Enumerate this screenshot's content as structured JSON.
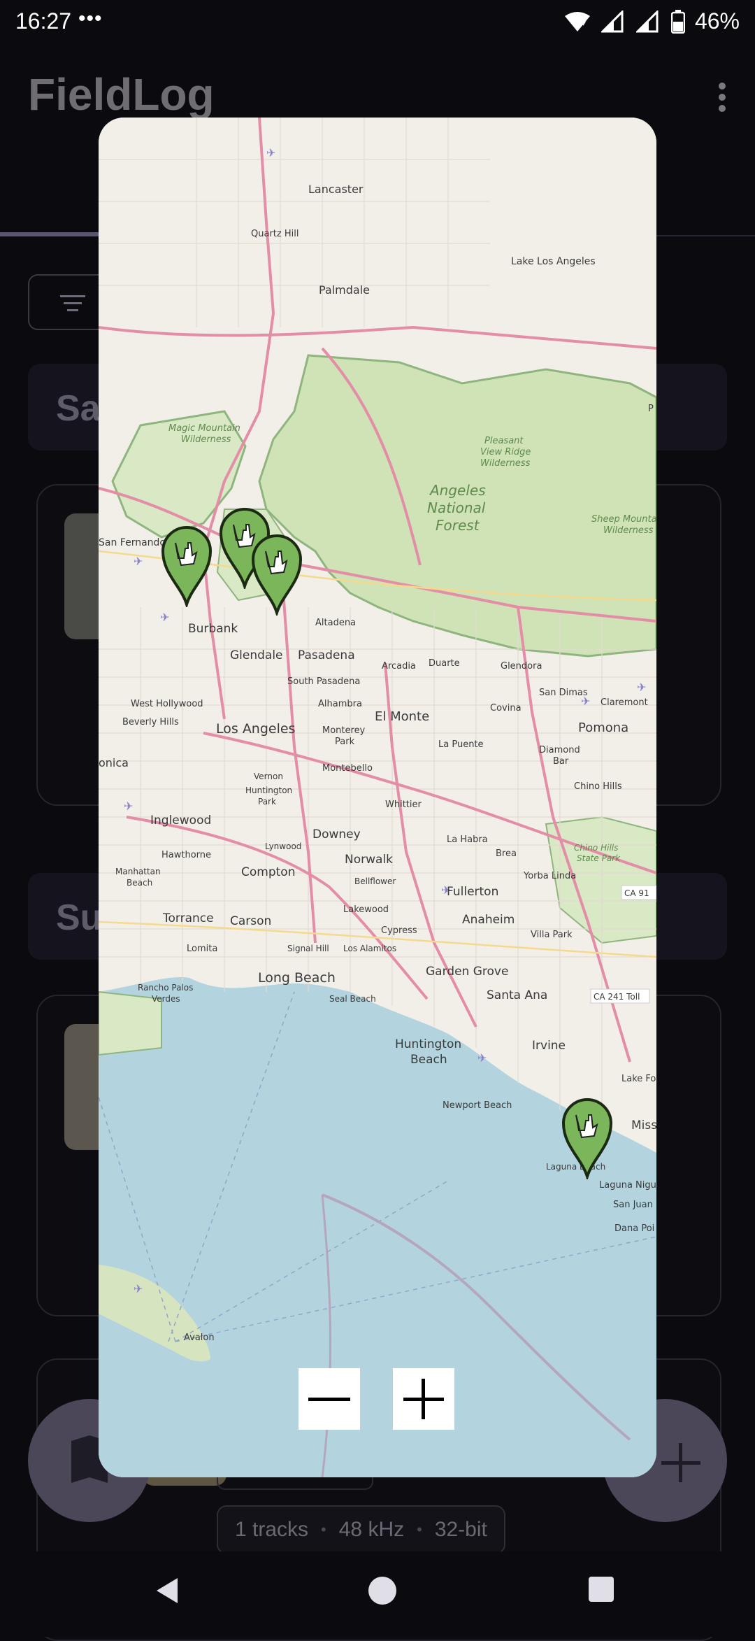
{
  "status_bar": {
    "time": "16:27",
    "overflow_dots": "•••",
    "battery": "46%"
  },
  "app_bar": {
    "title": "FieldLog"
  },
  "sections": [
    {
      "label": "Sa"
    },
    {
      "label": "Su"
    }
  ],
  "recording": {
    "tracks": "1 tracks",
    "sample_rate": "48 kHz",
    "bit_depth": "32-bit",
    "separator": "•"
  },
  "map": {
    "labels": {
      "lancaster": "Lancaster",
      "quartz_hill": "Quartz Hill",
      "palmdale": "Palmdale",
      "lake_los_angeles": "Lake Los Angeles",
      "magic_mountain": "Magic Mountain",
      "wilderness": "Wilderness",
      "pleasant_view_1": "Pleasant",
      "pleasant_view_2": "View Ridge",
      "angeles_1": "Angeles",
      "angeles_2": "National",
      "angeles_3": "Forest",
      "sheep_mountain": "Sheep Mountain",
      "san_fernando": "San Fernando",
      "burbank": "Burbank",
      "altadena": "Altadena",
      "glendale": "Glendale",
      "pasadena": "Pasadena",
      "arcadia": "Arcadia",
      "duarte": "Duarte",
      "glendora": "Glendora",
      "south_pasadena": "South Pasadena",
      "san_dimas": "San Dimas",
      "claremont": "Claremont",
      "west_hollywood": "West Hollywood",
      "alhambra": "Alhambra",
      "el_monte": "El Monte",
      "covina": "Covina",
      "beverly_hills": "Beverly Hills",
      "pomona": "Pomona",
      "los_angeles": "Los Angeles",
      "monterey": "Monterey",
      "park": "Park",
      "la_puente": "La Puente",
      "diamond": "Diamond",
      "bar": "Bar",
      "monica": "onica",
      "montebello": "Montebello",
      "vernon": "Vernon",
      "huntington": "Huntington",
      "chino_hills": "Chino Hills",
      "whittier": "Whittier",
      "inglewood": "Inglewood",
      "downey": "Downey",
      "lynwood": "Lynwood",
      "hawthorne": "Hawthorne",
      "la_habra": "La Habra",
      "chino_hills_sp_1": "Chino Hills",
      "chino_hills_sp_2": "State Park",
      "brea": "Brea",
      "manhattan_1": "Manhattan",
      "manhattan_2": "Beach",
      "compton": "Compton",
      "norwalk": "Norwalk",
      "yorba_linda": "Yorba Linda",
      "bellflower": "Bellflower",
      "fullerton": "Fullerton",
      "ca91": "CA 91",
      "lakewood": "Lakewood",
      "torrance": "Torrance",
      "carson": "Carson",
      "anaheim": "Anaheim",
      "cypress": "Cypress",
      "villa_park": "Villa Park",
      "lomita": "Lomita",
      "signal_hill": "Signal Hill",
      "los_alamitos": "Los Alamitos",
      "garden_grove": "Garden Grove",
      "long_beach": "Long Beach",
      "santa_ana": "Santa Ana",
      "ca241": "CA 241 Toll",
      "rancho_palos_1": "Rancho Palos",
      "rancho_palos_2": "Verdes",
      "seal_beach": "Seal Beach",
      "huntington_beach_1": "Huntington",
      "huntington_beach_2": "Beach",
      "irvine": "Irvine",
      "lake_forest": "Lake Fo",
      "newport_beach": "Newport Beach",
      "mission": "Miss",
      "laguna_beach": "Laguna Beach",
      "laguna_niguel": "Laguna Nigu",
      "san_juan": "San Juan",
      "dana_point": "Dana Poi",
      "avalon": "Avalon",
      "p": "P"
    }
  },
  "zoom": {
    "out": "−",
    "in": "+"
  },
  "markers": [
    {
      "label": "Recording location 1"
    },
    {
      "label": "Recording location 2"
    },
    {
      "label": "Recording location 3"
    },
    {
      "label": "Recording location 4"
    }
  ],
  "colors": {
    "marker_fill": "#7cb65a",
    "marker_stroke": "#1b2a12",
    "water": "#b3d4df",
    "land": "#f2efe9",
    "forest": "#cfe3b6",
    "road": "#e38ea6"
  }
}
